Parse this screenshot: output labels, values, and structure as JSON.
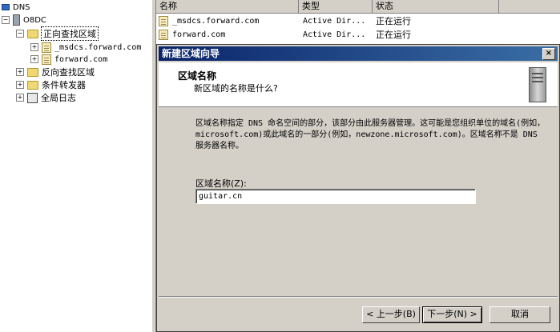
{
  "tree": {
    "root": "DNS",
    "server": "O8DC",
    "forward_zones": "正向查找区域",
    "msdcs_zone": "_msdcs.forward.com",
    "forward_zone": "forward.com",
    "reverse_zones": "反向查找区域",
    "conditional_forwarders": "条件转发器",
    "global_logs": "全局日志"
  },
  "list": {
    "columns": [
      "名称",
      "类型",
      "状态"
    ],
    "rows": [
      {
        "name": "_msdcs.forward.com",
        "type": "Active Dir...",
        "status": "正在运行"
      },
      {
        "name": "forward.com",
        "type": "Active Dir...",
        "status": "正在运行"
      }
    ]
  },
  "wizard": {
    "title": "新建区域向导",
    "close_glyph": "×",
    "header_title": "区域名称",
    "header_subtitle": "新区域的名称是什么?",
    "description": "区域名称指定 DNS 命名空间的部分，该部分由此服务器管理。这可能是您组织单位的域名(例如，microsoft.com)或此域名的一部分(例如，newzone.microsoft.com)。区域名称不是 DNS 服务器名称。",
    "name_label": "区域名称(Z):",
    "name_value": "guitar.cn",
    "back_label": "< 上一步(B)",
    "next_label": "下一步(N) >",
    "cancel_label": "取消"
  },
  "icons": {
    "expand_plus": "+",
    "collapse_minus": "−"
  }
}
